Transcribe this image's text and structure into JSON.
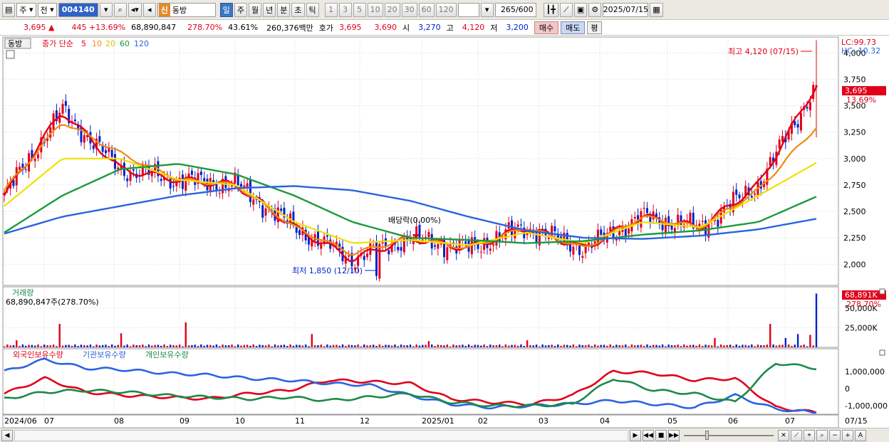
{
  "toolbar": {
    "market": "주",
    "scope": "전",
    "code": "004140",
    "badge": "신",
    "name": "동방",
    "periods": [
      "일",
      "주",
      "월",
      "년",
      "분",
      "초",
      "틱"
    ],
    "intervals": [
      "1",
      "3",
      "5",
      "10",
      "20",
      "30",
      "60",
      "120"
    ],
    "count": "265",
    "count_total": "/600",
    "date": "2025/07/15"
  },
  "quote": {
    "price": "3,695",
    "arrow": "▲",
    "change": "445",
    "change_pct": "+13.69%",
    "volume": "68,890,847",
    "volume_ratio": "278.70%",
    "turnover": "43.61%",
    "amount": "260,376백만",
    "hoga_label": "호가",
    "hoga_ask": "3,695",
    "hoga_bid": "3,690",
    "open_label": "시",
    "open": "3,270",
    "high_label": "고",
    "high": "4,120",
    "low_label": "저",
    "low": "3,200",
    "buy": "매수",
    "sell": "매도",
    "pyeong": "평"
  },
  "legend": {
    "name": "동방",
    "title": "종가 단순",
    "ma": [
      {
        "label": "5",
        "color": "#e0001a"
      },
      {
        "label": "10",
        "color": "#f08a10"
      },
      {
        "label": "20",
        "color": "#f0e000"
      },
      {
        "label": "60",
        "color": "#1c9a3c"
      },
      {
        "label": "120",
        "color": "#2a64e0"
      }
    ]
  },
  "overlay": {
    "lc": "LC:99.73",
    "hc": "HC:-10.32",
    "high_note": "최고 4,120 (07/15)",
    "low_note": "최저 1,850 (12/10)",
    "dividend_note": "배당락(0.00%)",
    "cur_price": "3,695",
    "cur_pct": "13.69%",
    "vol_title": "거래량",
    "vol_value": "68,890,847주(278.70%)",
    "vol_cur": "68,891K",
    "vol_pct": "278.70%",
    "flow_series": [
      {
        "label": "외국인보유수량",
        "color": "#e0001a"
      },
      {
        "label": "기관보유수량",
        "color": "#2a64e0"
      },
      {
        "label": "개인보유수량",
        "color": "#1c8a48"
      }
    ]
  },
  "chart_data": [
    {
      "type": "candlestick",
      "x_labels": [
        "2024/06",
        "07",
        "08",
        "09",
        "10",
        "11",
        "12",
        "2025/01",
        "02",
        "03",
        "04",
        "05",
        "06",
        "07",
        "07/15"
      ],
      "y_ticks": [
        2000,
        2250,
        2500,
        2750,
        3000,
        3250,
        3500,
        3750,
        4000
      ],
      "ylim": [
        1800,
        4150
      ],
      "series": [
        {
          "name": "5",
          "approx_close": [
            2650,
            3450,
            2900,
            2800,
            2750,
            2350,
            2050,
            2250,
            2150,
            2350,
            2150,
            2450,
            2350,
            2750,
            3695
          ]
        },
        {
          "name": "10",
          "approx_close": [
            2700,
            3350,
            3050,
            2800,
            2750,
            2350,
            2100,
            2250,
            2150,
            2350,
            2150,
            2450,
            2350,
            2700,
            3300
          ]
        },
        {
          "name": "20",
          "approx_close": [
            2550,
            3000,
            3000,
            2800,
            2750,
            2400,
            2200,
            2230,
            2180,
            2300,
            2200,
            2400,
            2350,
            2650,
            2960
          ]
        },
        {
          "name": "60",
          "approx_close": [
            2300,
            2650,
            2900,
            2950,
            2850,
            2650,
            2400,
            2250,
            2230,
            2200,
            2220,
            2280,
            2320,
            2400,
            2640
          ]
        },
        {
          "name": "120",
          "approx_close": [
            2290,
            2450,
            2550,
            2650,
            2720,
            2740,
            2700,
            2600,
            2450,
            2320,
            2250,
            2240,
            2270,
            2330,
            2430
          ]
        }
      ],
      "high": {
        "value": 4120,
        "date": "07/15"
      },
      "low": {
        "value": 1850,
        "date": "12/10"
      },
      "last": 3695
    },
    {
      "type": "bar",
      "title": "거래량",
      "y_ticks": [
        "25,000K",
        "50,000K"
      ],
      "last": 68891
    },
    {
      "type": "line",
      "y_ticks": [
        "1,000,000",
        "0",
        "-1,000,000"
      ],
      "series": [
        {
          "name": "외국인보유수량",
          "color": "#e0001a"
        },
        {
          "name": "기관보유수량",
          "color": "#2a64e0"
        },
        {
          "name": "개인보유수량",
          "color": "#1c8a48"
        }
      ]
    }
  ]
}
